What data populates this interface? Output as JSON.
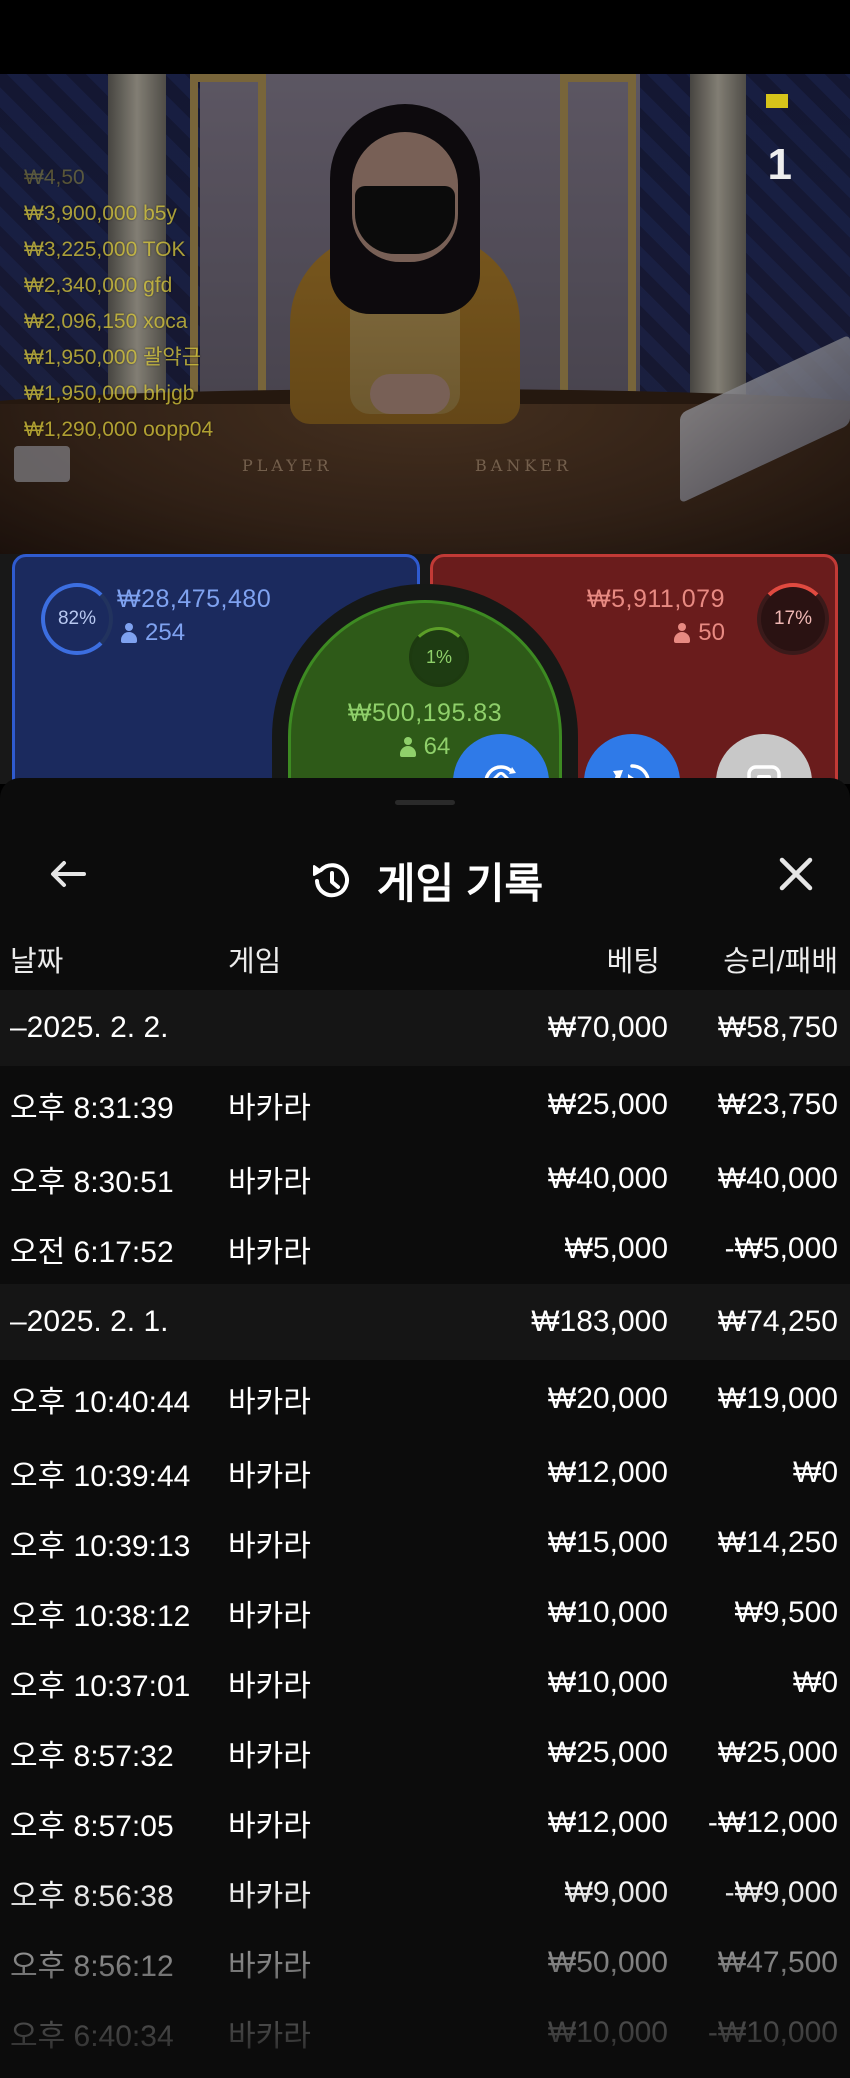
{
  "leaderboard": [
    "₩4,50",
    "₩3,900,000  b5y",
    "₩3,225,000  TOK",
    "₩2,340,000  gfd",
    "₩2,096,150  xoca",
    "₩1,950,000  괄약근",
    "₩1,950,000  bhjgb",
    "₩1,290,000  oopp04"
  ],
  "video": {
    "round_number": "1",
    "table_player_label": "PLAYER",
    "table_banker_label": "BANKER"
  },
  "betting": {
    "player": {
      "percent": "82%",
      "amount": "₩28,475,480",
      "count": "254"
    },
    "banker": {
      "percent": "17%",
      "amount": "₩5,911,079",
      "count": "50"
    },
    "tie": {
      "percent": "1%",
      "amount": "₩500,195.83",
      "count": "64"
    }
  },
  "history": {
    "title": "게임 기록",
    "columns": {
      "date": "날짜",
      "game": "게임",
      "bet": "베팅",
      "win": "승리/패배"
    },
    "rows": [
      {
        "type": "date",
        "time": "–2025. 2. 2.",
        "game": "",
        "bet": "₩70,000",
        "win": "₩58,750"
      },
      {
        "type": "entry",
        "time": "오후 8:31:39",
        "game": "바카라",
        "bet": "₩25,000",
        "win": "₩23,750"
      },
      {
        "type": "entry",
        "time": "오후 8:30:51",
        "game": "바카라",
        "bet": "₩40,000",
        "win": "₩40,000"
      },
      {
        "type": "entry",
        "time": "오전 6:17:52",
        "game": "바카라",
        "bet": "₩5,000",
        "win": "-₩5,000"
      },
      {
        "type": "date",
        "time": "–2025. 2. 1.",
        "game": "",
        "bet": "₩183,000",
        "win": "₩74,250"
      },
      {
        "type": "entry",
        "time": "오후 10:40:44",
        "game": "바카라",
        "bet": "₩20,000",
        "win": "₩19,000"
      },
      {
        "type": "entry",
        "time": "오후 10:39:44",
        "game": "바카라",
        "bet": "₩12,000",
        "win": "₩0"
      },
      {
        "type": "entry",
        "time": "오후 10:39:13",
        "game": "바카라",
        "bet": "₩15,000",
        "win": "₩14,250"
      },
      {
        "type": "entry",
        "time": "오후 10:38:12",
        "game": "바카라",
        "bet": "₩10,000",
        "win": "₩9,500"
      },
      {
        "type": "entry",
        "time": "오후 10:37:01",
        "game": "바카라",
        "bet": "₩10,000",
        "win": "₩0"
      },
      {
        "type": "entry",
        "time": "오후 8:57:32",
        "game": "바카라",
        "bet": "₩25,000",
        "win": "₩25,000"
      },
      {
        "type": "entry",
        "time": "오후 8:57:05",
        "game": "바카라",
        "bet": "₩12,000",
        "win": "-₩12,000"
      },
      {
        "type": "entry",
        "time": "오후 8:56:38",
        "game": "바카라",
        "bet": "₩9,000",
        "win": "-₩9,000"
      },
      {
        "type": "entry",
        "time": "오후 8:56:12",
        "game": "바카라",
        "bet": "₩50,000",
        "win": "₩47,500"
      },
      {
        "type": "entry",
        "time": "오후 6:40:34",
        "game": "바카라",
        "bet": "₩10,000",
        "win": "-₩10,000"
      }
    ]
  },
  "colors": {
    "player": "#2f5bd0",
    "banker": "#c23a36",
    "tie": "#3d8a22",
    "fab_blue": "#2f7ae8",
    "leaderboard_text": "#d4c43a"
  },
  "icons": {
    "back": "arrow-left-icon",
    "close": "close-icon",
    "history": "history-clock-icon",
    "swap": "swap-icon",
    "replay": "replay-icon",
    "stop": "stop-icon"
  }
}
